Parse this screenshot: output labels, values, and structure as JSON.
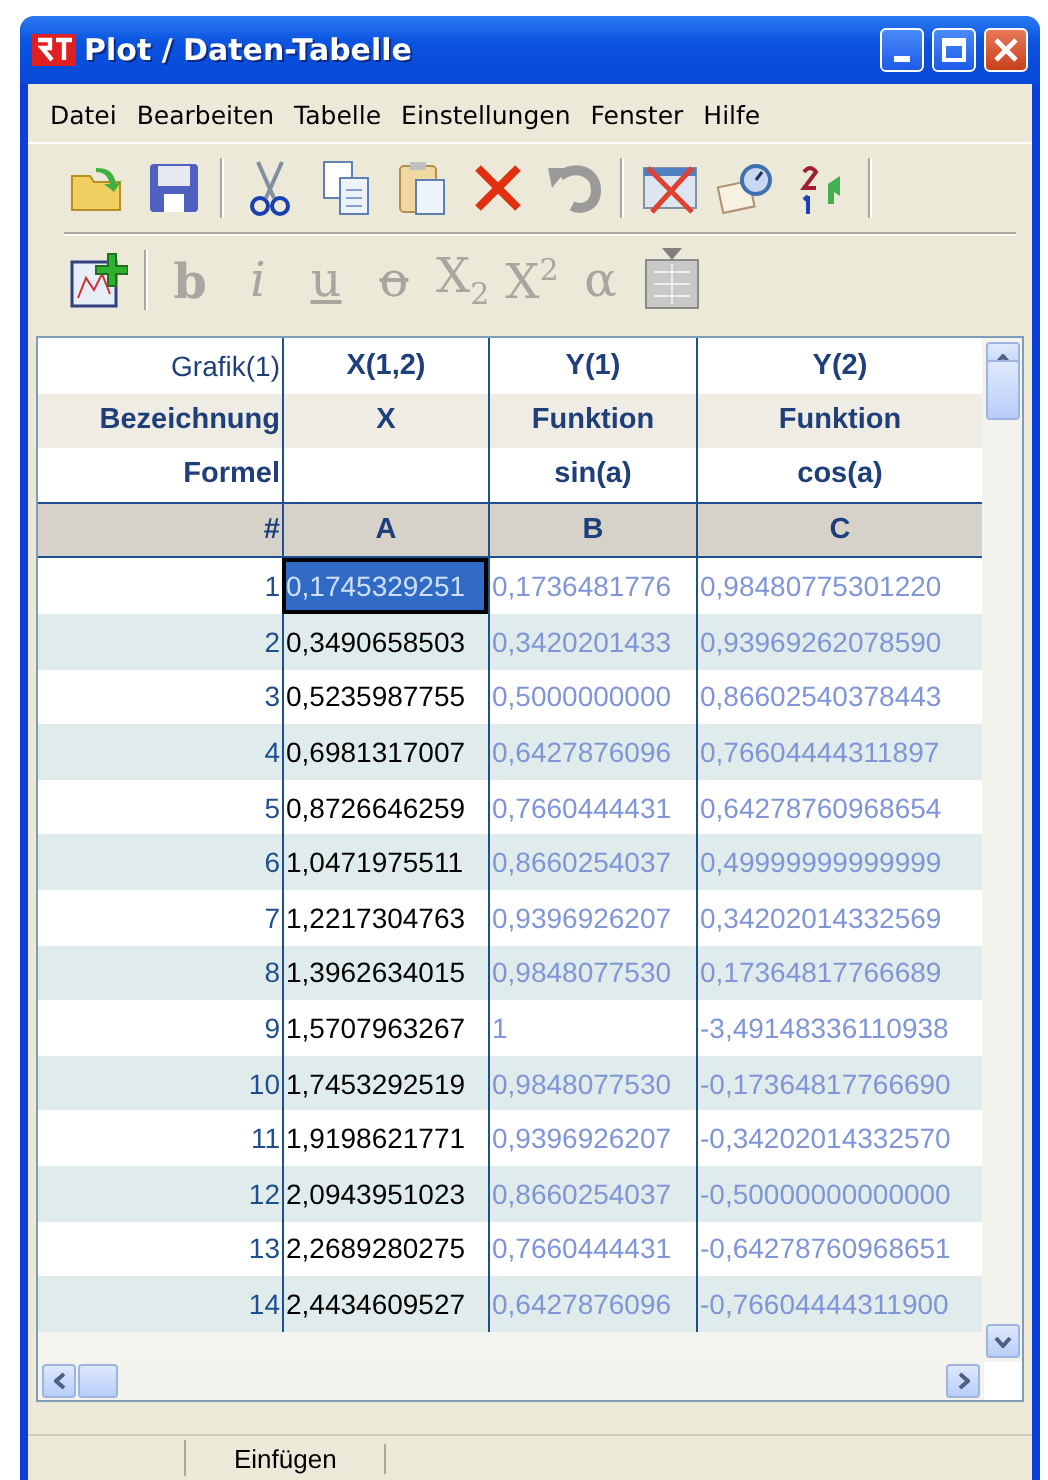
{
  "window": {
    "title": "Plot / Daten-Tabelle"
  },
  "menu": [
    "Datei",
    "Bearbeiten",
    "Tabelle",
    "Einstellungen",
    "Fenster",
    "Hilfe"
  ],
  "toolbar_1": [
    {
      "kind": "open",
      "disabled": false
    },
    {
      "kind": "save",
      "disabled": false
    },
    {
      "kind": "sep"
    },
    {
      "kind": "cut",
      "disabled": false
    },
    {
      "kind": "copy",
      "disabled": false
    },
    {
      "kind": "paste",
      "disabled": false
    },
    {
      "kind": "delete",
      "disabled": false
    },
    {
      "kind": "undo",
      "disabled": true
    },
    {
      "kind": "sep"
    },
    {
      "kind": "clear-chart",
      "disabled": false
    },
    {
      "kind": "settings",
      "disabled": false
    },
    {
      "kind": "sort",
      "disabled": false
    },
    {
      "kind": "sep"
    }
  ],
  "toolbar_2": [
    {
      "kind": "add-chart",
      "disabled": false
    },
    {
      "kind": "sep"
    },
    {
      "kind": "bold",
      "label": "b",
      "disabled": true
    },
    {
      "kind": "italic",
      "label": "i",
      "disabled": true
    },
    {
      "kind": "underline",
      "label": "u",
      "disabled": true
    },
    {
      "kind": "strike",
      "label": "o",
      "disabled": true
    },
    {
      "kind": "text",
      "label": "X$_{2}$",
      "disabled": true
    },
    {
      "kind": "text",
      "label": "X$^{2}$",
      "disabled": true
    },
    {
      "kind": "text",
      "label": "α",
      "disabled": true
    },
    {
      "kind": "symbol",
      "disabled": true
    }
  ],
  "table": {
    "row_labels": {
      "graph": "Grafik(1)",
      "name": "Bezeichnung",
      "formula": "Formel",
      "letter": "#"
    },
    "columns": [
      {
        "graph": "X(1,2)",
        "name": "X",
        "letter": "A",
        "computed": false
      },
      {
        "graph": "Y(1)",
        "name": "Funktion",
        "formula": "sin(a)",
        "letter": "B",
        "computed": true
      },
      {
        "graph": "Y(2)",
        "name": "Funktion",
        "formula": "cos(a)",
        "letter": "C",
        "computed": true
      }
    ],
    "rows": [
      {
        "index": "1",
        "cells": [
          {
            "value": "0,1745329251",
            "selected": true
          },
          {
            "value": "0,1736481776",
            "selected": false
          },
          {
            "value": "0,98480775301220",
            "selected": false
          }
        ]
      },
      {
        "index": "2",
        "cells": [
          {
            "value": "0,3490658503",
            "selected": false
          },
          {
            "value": "0,3420201433",
            "selected": false
          },
          {
            "value": "0,93969262078590",
            "selected": false
          }
        ]
      },
      {
        "index": "3",
        "cells": [
          {
            "value": "0,5235987755",
            "selected": false
          },
          {
            "value": "0,5000000000",
            "selected": false
          },
          {
            "value": "0,86602540378443",
            "selected": false
          }
        ]
      },
      {
        "index": "4",
        "cells": [
          {
            "value": "0,6981317007",
            "selected": false
          },
          {
            "value": "0,6427876096",
            "selected": false
          },
          {
            "value": "0,76604444311897",
            "selected": false
          }
        ]
      },
      {
        "index": "5",
        "cells": [
          {
            "value": "0,8726646259",
            "selected": false
          },
          {
            "value": "0,7660444431",
            "selected": false
          },
          {
            "value": "0,64278760968654",
            "selected": false
          }
        ]
      },
      {
        "index": "6",
        "cells": [
          {
            "value": "1,0471975511",
            "selected": false
          },
          {
            "value": "0,8660254037",
            "selected": false
          },
          {
            "value": "0,49999999999999",
            "selected": false
          }
        ]
      },
      {
        "index": "7",
        "cells": [
          {
            "value": "1,2217304763",
            "selected": false
          },
          {
            "value": "0,9396926207",
            "selected": false
          },
          {
            "value": "0,34202014332569",
            "selected": false
          }
        ]
      },
      {
        "index": "8",
        "cells": [
          {
            "value": "1,3962634015",
            "selected": false
          },
          {
            "value": "0,9848077530",
            "selected": false
          },
          {
            "value": "0,17364817766689",
            "selected": false
          }
        ]
      },
      {
        "index": "9",
        "cells": [
          {
            "value": "1,5707963267",
            "selected": false
          },
          {
            "value": "1",
            "selected": false
          },
          {
            "value": "-3,49148336110938",
            "selected": false
          }
        ]
      },
      {
        "index": "10",
        "cells": [
          {
            "value": "1,7453292519",
            "selected": false
          },
          {
            "value": "0,9848077530",
            "selected": false
          },
          {
            "value": "-0,17364817766690",
            "selected": false
          }
        ]
      },
      {
        "index": "11",
        "cells": [
          {
            "value": "1,9198621771",
            "selected": false
          },
          {
            "value": "0,9396926207",
            "selected": false
          },
          {
            "value": "-0,34202014332570",
            "selected": false
          }
        ]
      },
      {
        "index": "12",
        "cells": [
          {
            "value": "2,0943951023",
            "selected": false
          },
          {
            "value": "0,8660254037",
            "selected": false
          },
          {
            "value": "-0,50000000000000",
            "selected": false
          }
        ]
      },
      {
        "index": "13",
        "cells": [
          {
            "value": "2,2689280275",
            "selected": false
          },
          {
            "value": "0,7660444431",
            "selected": false
          },
          {
            "value": "-0,64278760968651",
            "selected": false
          }
        ]
      },
      {
        "index": "14",
        "cells": [
          {
            "value": "2,4434609527",
            "selected": false
          },
          {
            "value": "0,6427876096",
            "selected": false
          },
          {
            "value": "-0,76604444311900",
            "selected": false
          }
        ]
      }
    ]
  },
  "status_bar": {
    "mode": "Einfügen"
  }
}
